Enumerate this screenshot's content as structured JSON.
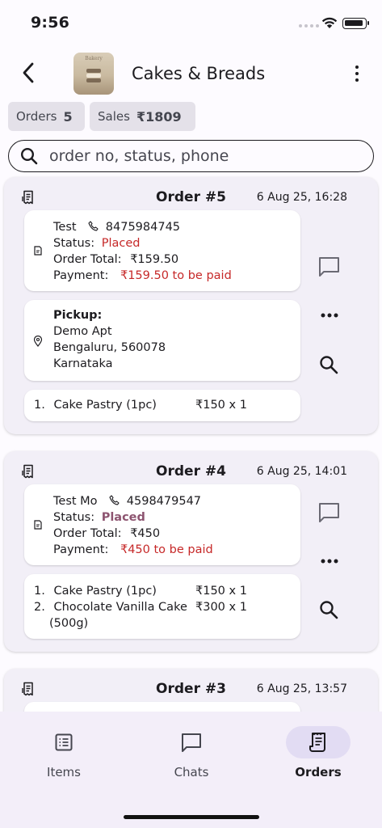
{
  "status_bar": {
    "time": "9:56"
  },
  "app_bar": {
    "store_name": "Cakes & Breads",
    "avatar_caption": "Bakery"
  },
  "stats": {
    "orders_label": "Orders",
    "orders_value": "5",
    "sales_label": "Sales",
    "sales_value": "₹1809"
  },
  "search": {
    "placeholder": "order no, status, phone"
  },
  "orders": [
    {
      "title": "Order #5",
      "date": "6 Aug 25, 16:28",
      "customer": "Test",
      "phone": "8475984745",
      "status_label": "Status:",
      "status": "Placed",
      "total_label": "Order Total:",
      "total": "₹159.50",
      "payment_label": "Payment:",
      "payment": "₹159.50 to be paid",
      "pickup_label": "Pickup:",
      "address": [
        "Demo Apt",
        "Bengaluru, 560078",
        "Karnataka"
      ],
      "items": [
        {
          "num": "1.",
          "name": "Cake Pastry (1pc)",
          "qty": "₹150 x 1"
        }
      ]
    },
    {
      "title": "Order #4",
      "date": "6 Aug 25, 14:01",
      "customer": "Test Mo",
      "phone": "4598479547",
      "status_label": "Status:",
      "status": "Placed",
      "total_label": "Order Total:",
      "total": "₹450",
      "payment_label": "Payment:",
      "payment": "₹450 to be paid",
      "items": [
        {
          "num": "1.",
          "name": "Cake Pastry (1pc)",
          "qty": "₹150 x 1"
        },
        {
          "num": "2.",
          "name": "Chocolate Vanilla Cake",
          "name2": "(500g)",
          "qty": "₹300 x 1"
        }
      ]
    },
    {
      "title": "Order #3",
      "date": "6 Aug 25, 13:57"
    }
  ],
  "bottom_nav": {
    "items_label": "Items",
    "chats_label": "Chats",
    "orders_label": "Orders",
    "active": "Orders"
  },
  "colors": {
    "accent_red": "#c62828",
    "status_purple": "#8d5470",
    "nav_active_bg": "#e2dcf3"
  }
}
